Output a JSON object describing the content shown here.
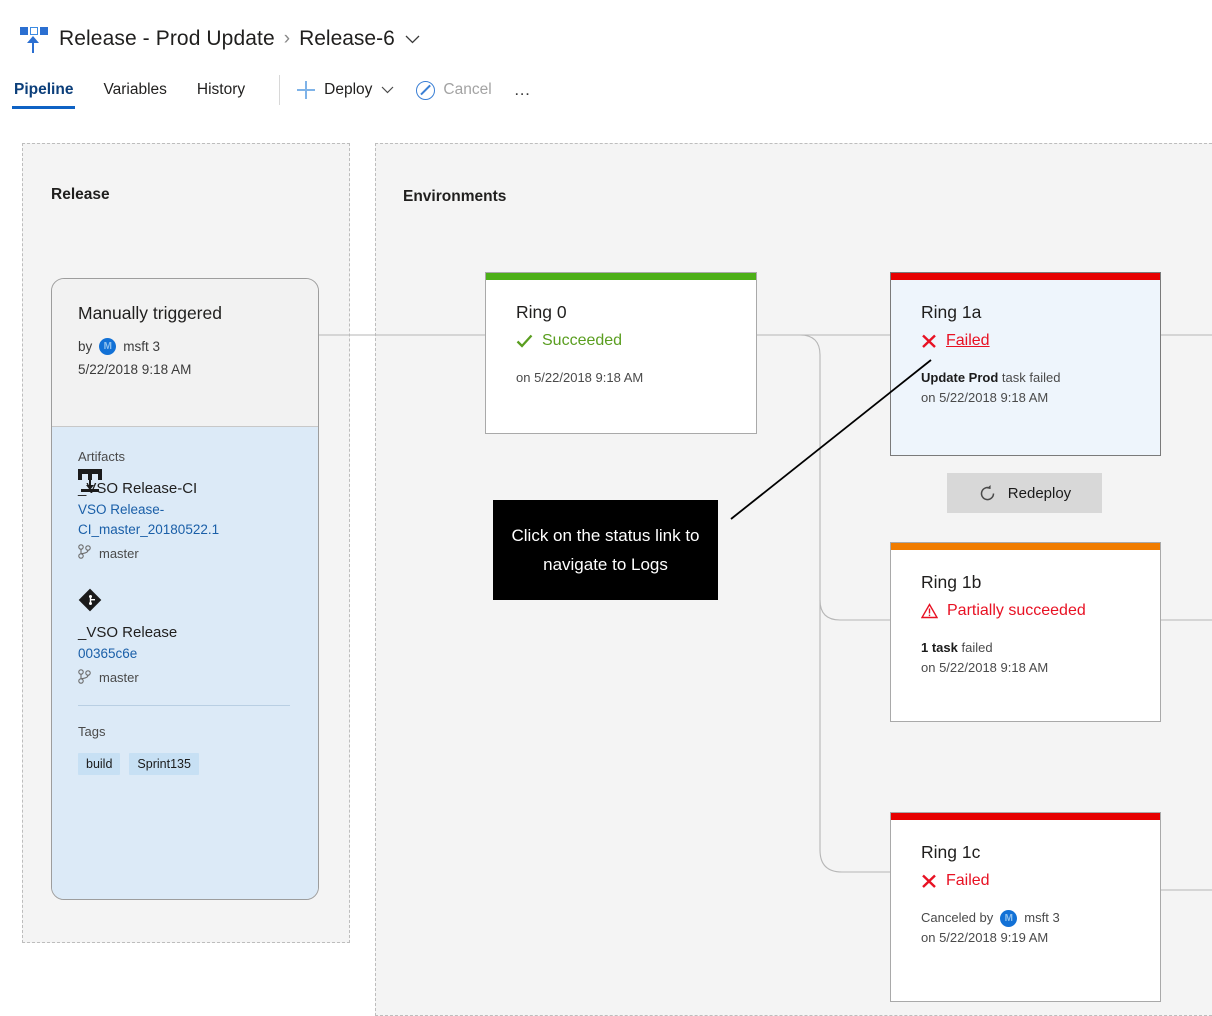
{
  "header": {
    "app_icon": "release-pipeline-icon",
    "breadcrumb_root": "Release - Prod Update",
    "breadcrumb_separator": "›",
    "breadcrumb_current": "Release-6",
    "tabs": [
      {
        "label": "Pipeline",
        "active": true
      },
      {
        "label": "Variables",
        "active": false
      },
      {
        "label": "History",
        "active": false
      }
    ],
    "actions": {
      "deploy_label": "Deploy",
      "cancel_label": "Cancel",
      "more_label": "…"
    }
  },
  "panes": {
    "release_title": "Release",
    "environments_title": "Environments"
  },
  "release_card": {
    "title": "Manually triggered",
    "by_prefix": "by",
    "avatar_initial": "M",
    "by_user": "msft 3",
    "date": "5/22/2018 9:18 AM",
    "artifacts_label": "Artifacts",
    "artifacts": [
      {
        "icon": "build-artifact-icon",
        "name": "_VSO Release-CI",
        "version": "VSO Release-CI_master_20180522.1",
        "branch": "master"
      },
      {
        "icon": "git-repository-icon",
        "name": "_VSO Release",
        "version": "00365c6e",
        "branch": "master"
      }
    ],
    "tags_label": "Tags",
    "tags": [
      "build",
      "Sprint135"
    ]
  },
  "environments": [
    {
      "id": "ring-0",
      "name": "Ring 0",
      "status": "Succeeded",
      "status_icon": "checkmark-icon",
      "status_color": "#5a9e20",
      "bar_color": "#4caf17",
      "selected": false,
      "status_is_link": false,
      "meta_bold": "",
      "meta_rest": "",
      "meta_line2": "on 5/22/2018 9:18 AM",
      "has_user": false
    },
    {
      "id": "ring-1a",
      "name": "Ring 1a",
      "status": "Failed",
      "status_icon": "x-cross-icon",
      "status_color": "#e81123",
      "bar_color": "#e60000",
      "selected": true,
      "status_is_link": true,
      "meta_bold": "Update Prod",
      "meta_rest": " task failed",
      "meta_line2": "on 5/22/2018 9:18 AM",
      "has_user": false,
      "button_label": "Redeploy",
      "button_icon": "refresh-circle-icon"
    },
    {
      "id": "ring-1b",
      "name": "Ring 1b",
      "status": "Partially succeeded",
      "status_icon": "warning-triangle-icon",
      "status_color": "#e81123",
      "bar_color": "#f07c00",
      "selected": false,
      "status_is_link": false,
      "meta_bold": "1 task",
      "meta_rest": " failed",
      "meta_line2": "on 5/22/2018 9:18 AM",
      "has_user": false
    },
    {
      "id": "ring-1c",
      "name": "Ring 1c",
      "status": "Failed",
      "status_icon": "x-cross-icon",
      "status_color": "#e81123",
      "bar_color": "#e60000",
      "selected": false,
      "status_is_link": false,
      "meta_bold": "",
      "meta_rest": "Canceled by",
      "meta_user": "msft 3",
      "avatar_initial": "M",
      "meta_line2": "on 5/22/2018 9:19 AM",
      "has_user": true
    }
  ],
  "callout": {
    "text": "Click on the status link to navigate to Logs"
  },
  "colors": {
    "accent": "#0e62c4",
    "success": "#4caf17",
    "failed": "#e60000",
    "partial": "#f07c00",
    "link": "#1a5fa8",
    "selected_card_bg": "#eef5fc"
  }
}
